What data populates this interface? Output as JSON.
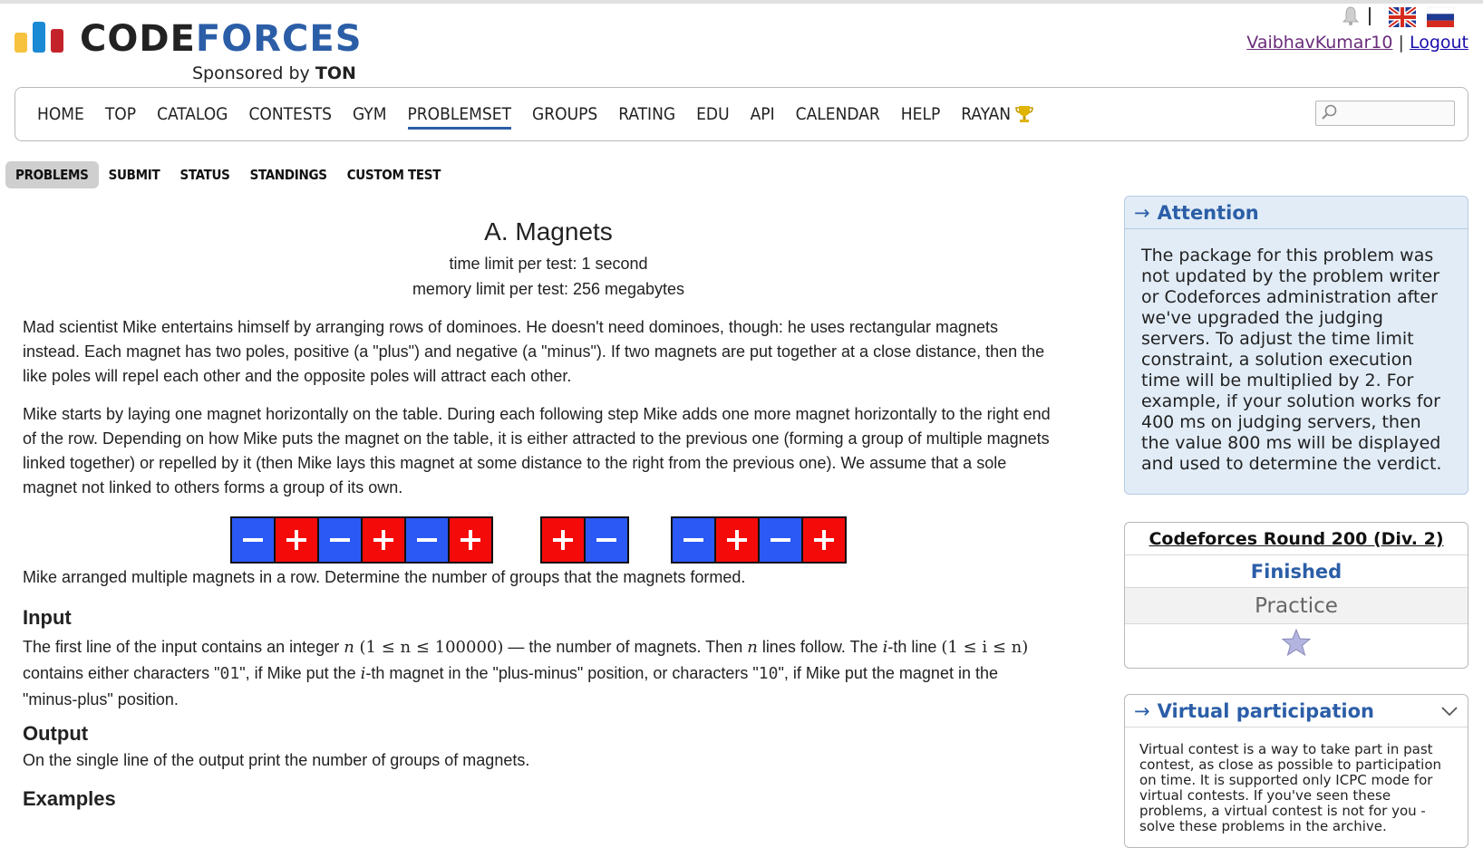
{
  "header": {
    "logo_code": "CODE",
    "logo_forces": "FORCES",
    "sponsor_prefix": "Sponsored by",
    "sponsor_name": "TON",
    "username": "VaibhavKumar10",
    "separator": "|",
    "logout": "Logout"
  },
  "menu": {
    "items": [
      "HOME",
      "TOP",
      "CATALOG",
      "CONTESTS",
      "GYM",
      "PROBLEMSET",
      "GROUPS",
      "RATING",
      "EDU",
      "API",
      "CALENDAR",
      "HELP",
      "RAYAN"
    ],
    "current": "PROBLEMSET"
  },
  "submenu": {
    "items": [
      "PROBLEMS",
      "SUBMIT",
      "STATUS",
      "STANDINGS",
      "CUSTOM TEST"
    ],
    "active": "PROBLEMS"
  },
  "problem": {
    "title": "A. Magnets",
    "time_limit": "time limit per test: 1 second",
    "memory_limit": "memory limit per test: 256 megabytes",
    "p1": "Mad scientist Mike entertains himself by arranging rows of dominoes. He doesn't need dominoes, though: he uses rectangular magnets instead. Each magnet has two poles, positive (a \"plus\") and negative (a \"minus\"). If two magnets are put together at a close distance, then the like poles will repel each other and the opposite poles will attract each other.",
    "p2": "Mike starts by laying one magnet horizontally on the table. During each following step Mike adds one more magnet horizontally to the right end of the row. Depending on how Mike puts the magnet on the table, it is either attracted to the previous one (forming a group of multiple magnets linked together) or repelled by it (then Mike lays this magnet at some distance to the right from the previous one). We assume that a sole magnet not linked to others forms a group of its own.",
    "caption": "Mike arranged multiple magnets in a row. Determine the number of groups that the magnets formed.",
    "input_title": "Input",
    "input_a": "The first line of the input contains an integer ",
    "input_n": "n",
    "input_range": " (1 ≤ n ≤ 100000)",
    "input_b": " — the number of magnets. Then ",
    "input_c": " lines follow. The ",
    "input_i": "i",
    "input_d": "-th line ",
    "input_range2": "(1 ≤ i ≤ n)",
    "input_e": " contains either characters \"",
    "code_01": "01",
    "input_f": "\", if Mike put the ",
    "input_g": "-th magnet in the \"plus-minus\" position, or characters \"",
    "code_10": "10",
    "input_h": "\", if Mike put the magnet in the \"minus-plus\" position.",
    "output_title": "Output",
    "output_text": "On the single line of the output print the number of groups of magnets.",
    "example_stub": "Examples"
  },
  "magnet_groups": [
    [
      "minus",
      "plus",
      "minus",
      "plus",
      "minus",
      "plus"
    ],
    [
      "plus",
      "minus"
    ],
    [
      "minus",
      "plus",
      "minus",
      "plus"
    ]
  ],
  "colors": {
    "minus": "#2b59f5",
    "plus": "#f50a0a",
    "accent": "#2b5ea7"
  },
  "sidebar": {
    "attention_title": "Attention",
    "attention_text": "The package for this problem was not updated by the problem writer or Codeforces administration after we've upgraded the judging servers. To adjust the time limit constraint, a solution execution time will be multiplied by 2. For example, if your solution works for 400 ms on judging servers, then the value 800 ms will be displayed and used to determine the verdict.",
    "round_title": "Codeforces Round 200 (Div. 2)",
    "round_status": "Finished",
    "round_practice": "Practice",
    "virtual_title": "Virtual participation",
    "virtual_text": "Virtual contest is a way to take part in past contest, as close as possible to participation on time. It is supported only ICPC mode for virtual contests. If you've seen these problems, a virtual contest is not for you - solve these problems in the archive."
  }
}
